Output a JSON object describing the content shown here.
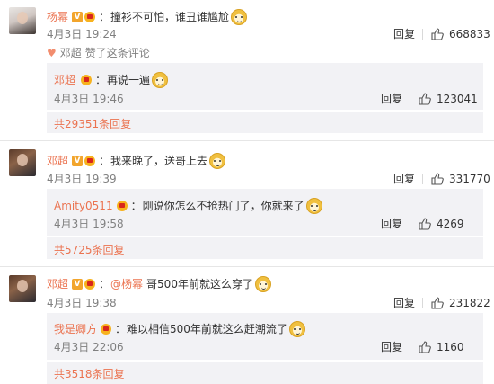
{
  "comments": [
    {
      "user": "杨幂",
      "text": "撞衫不可怕，谁丑谁尴尬",
      "time": "4月3日 19:24",
      "reply_label": "回复",
      "likes": "668833",
      "liked_by": {
        "user": "邓超",
        "text": "赞了这条评论"
      },
      "sub": {
        "user": "邓超",
        "text": "再说一遍",
        "time": "4月3日 19:46",
        "reply_label": "回复",
        "likes": "123041"
      },
      "more": "共29351条回复"
    },
    {
      "user": "邓超",
      "text": "我来晚了，送哥上去",
      "time": "4月3日 19:39",
      "reply_label": "回复",
      "likes": "331770",
      "sub": {
        "user": "Amity0511",
        "text": "刚说你怎么不抢热门了，你就来了",
        "time": "4月3日 19:58",
        "reply_label": "回复",
        "likes": "4269"
      },
      "more": "共5725条回复"
    },
    {
      "user": "邓超",
      "mention": "@杨幂",
      "text": "哥500年前就这么穿了",
      "time": "4月3日 19:38",
      "reply_label": "回复",
      "likes": "231822",
      "sub": {
        "user": "我是卿方",
        "text": "难以相信500年前就这么赶潮流了",
        "time": "4月3日 22:06",
        "reply_label": "回复",
        "likes": "1160"
      },
      "more": "共3518条回复"
    }
  ],
  "badges": {
    "verified": "V"
  },
  "colors": {
    "username": "#eb7350",
    "subbox": "#f2f2f5",
    "meta": "#808080"
  }
}
